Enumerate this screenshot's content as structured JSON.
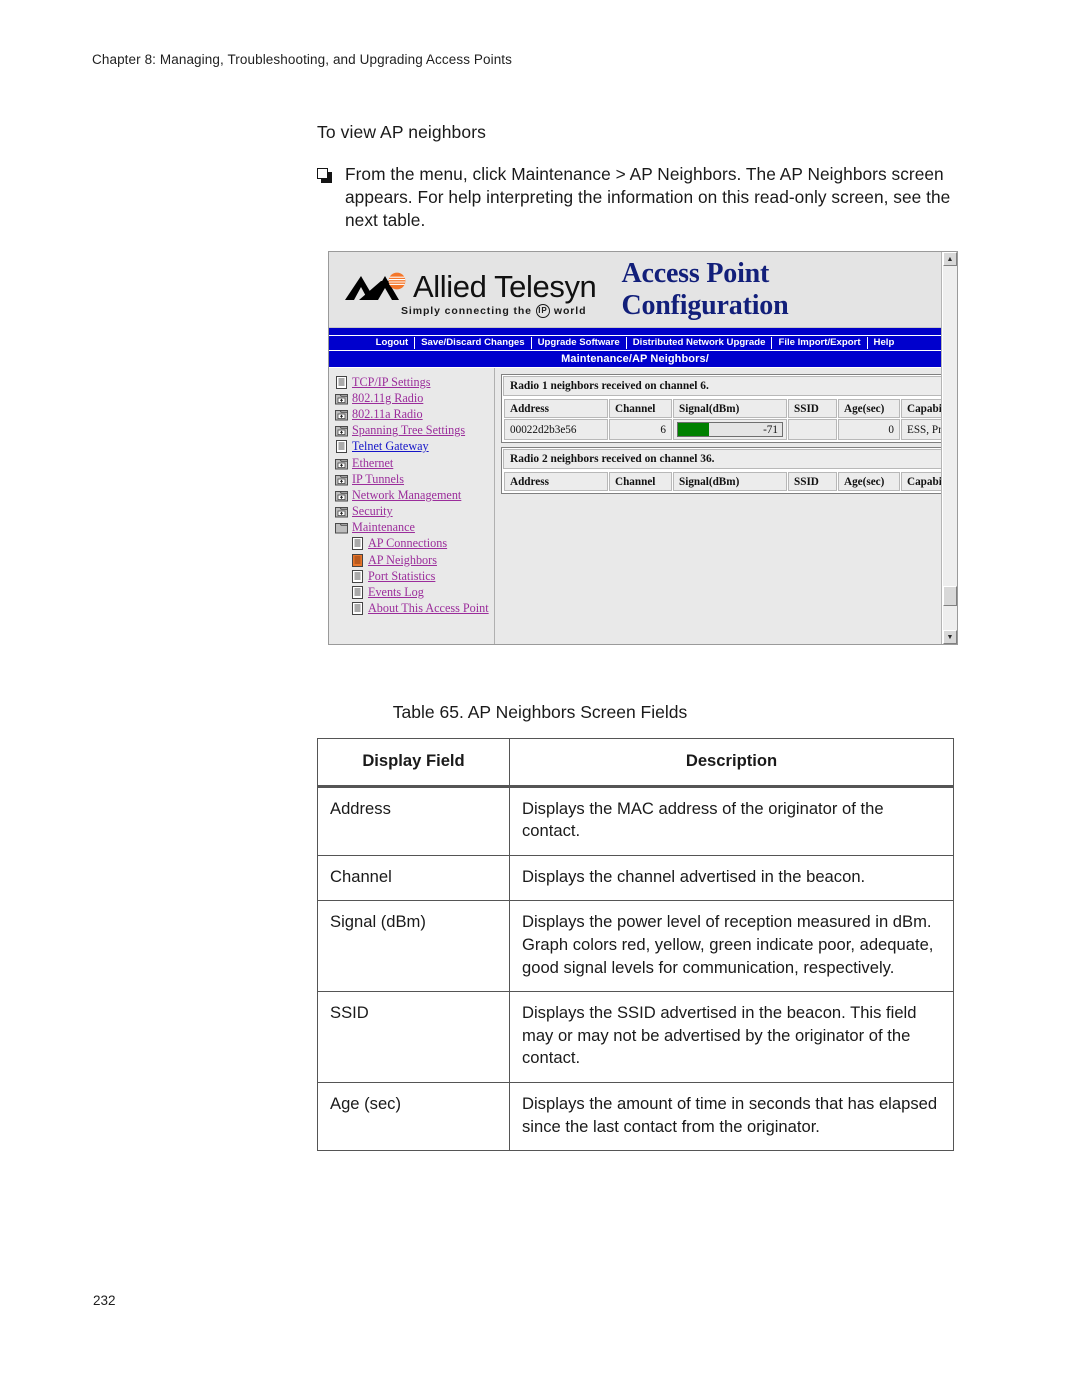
{
  "page": {
    "running_head": "Chapter 8: Managing, Troubleshooting, and Upgrading Access Points",
    "folio": "232"
  },
  "procedure": {
    "heading": "To view AP neighbors",
    "step_text": "From the menu, click Maintenance > AP Neighbors. The AP Neighbors screen appears. For help interpreting the information on this read-only screen, see the next table."
  },
  "figure": {
    "banner": {
      "brand_name": "Allied Telesyn",
      "tagline_before": "Simply connecting the",
      "tagline_badge": "IP",
      "tagline_after": "world",
      "title": "Access Point Configuration",
      "title_color": "#121f7a"
    },
    "navbar": {
      "items": [
        "Logout",
        "Save/Discard Changes",
        "Upgrade Software",
        "Distributed Network Upgrade",
        "File Import/Export",
        "Help"
      ],
      "bar_color": "#0000cd"
    },
    "breadcrumb": "Maintenance/AP Neighbors/",
    "tree": {
      "items": [
        {
          "label": "TCP/IP Settings",
          "icon": "page-icon",
          "level": 0,
          "state": "normal"
        },
        {
          "label": "802.11g Radio",
          "icon": "folder-plus-icon",
          "level": 0,
          "state": "normal"
        },
        {
          "label": "802.11a Radio",
          "icon": "folder-plus-icon",
          "level": 0,
          "state": "normal"
        },
        {
          "label": "Spanning Tree Settings",
          "icon": "folder-plus-icon",
          "level": 0,
          "state": "normal"
        },
        {
          "label": "Telnet Gateway",
          "icon": "page-icon",
          "level": 0,
          "state": "visited"
        },
        {
          "label": "Ethernet",
          "icon": "folder-plus-icon",
          "level": 0,
          "state": "normal"
        },
        {
          "label": "IP Tunnels",
          "icon": "folder-plus-icon",
          "level": 0,
          "state": "normal"
        },
        {
          "label": "Network Management",
          "icon": "folder-plus-icon",
          "level": 0,
          "state": "normal"
        },
        {
          "label": "Security",
          "icon": "folder-plus-icon",
          "level": 0,
          "state": "normal"
        },
        {
          "label": "Maintenance",
          "icon": "folder-open-icon",
          "level": 0,
          "state": "normal"
        },
        {
          "label": "AP Connections",
          "icon": "page-icon",
          "level": 1,
          "state": "normal"
        },
        {
          "label": "AP Neighbors",
          "icon": "page-selected-icon",
          "level": 1,
          "state": "selected"
        },
        {
          "label": "Port Statistics",
          "icon": "page-icon",
          "level": 1,
          "state": "normal"
        },
        {
          "label": "Events Log",
          "icon": "page-icon",
          "level": 1,
          "state": "normal"
        },
        {
          "label": "About This Access Point",
          "icon": "page-icon",
          "level": 1,
          "state": "normal"
        }
      ],
      "selected_highlight_color": "#e8762a"
    },
    "radio1": {
      "caption": "Radio 1 neighbors received on channel 6.",
      "headers": [
        "Address",
        "Channel",
        "Signal(dBm)",
        "SSID",
        "Age(sec)",
        "Capabilities"
      ],
      "rows": [
        {
          "address": "00022d2b3e56",
          "channel": "6",
          "signal_value": "-71",
          "signal_fill_percent": 30,
          "signal_color": "#008000",
          "ssid": "",
          "age": "0",
          "capabilities": "ESS, Privacy"
        }
      ]
    },
    "radio2": {
      "caption": "Radio 2 neighbors received on channel 36.",
      "headers": [
        "Address",
        "Channel",
        "Signal(dBm)",
        "SSID",
        "Age(sec)",
        "Capabilities"
      ],
      "rows": []
    }
  },
  "doc_table": {
    "caption": "Table 65. AP Neighbors Screen Fields",
    "headers": [
      "Display Field",
      "Description"
    ],
    "rows": [
      {
        "field": "Address",
        "description": "Displays the MAC address of the originator of the contact."
      },
      {
        "field": "Channel",
        "description": "Displays the channel advertised in the beacon."
      },
      {
        "field": "Signal (dBm)",
        "description": "Displays the power level of reception measured in dBm. Graph colors red, yellow, green indicate poor, adequate, good signal levels for communication, respectively."
      },
      {
        "field": "SSID",
        "description": "Displays the SSID advertised in the beacon. This field may or may not be advertised by the originator of the contact."
      },
      {
        "field": "Age (sec)",
        "description": "Displays the amount of time in seconds that has elapsed since the last contact from the originator."
      }
    ]
  }
}
